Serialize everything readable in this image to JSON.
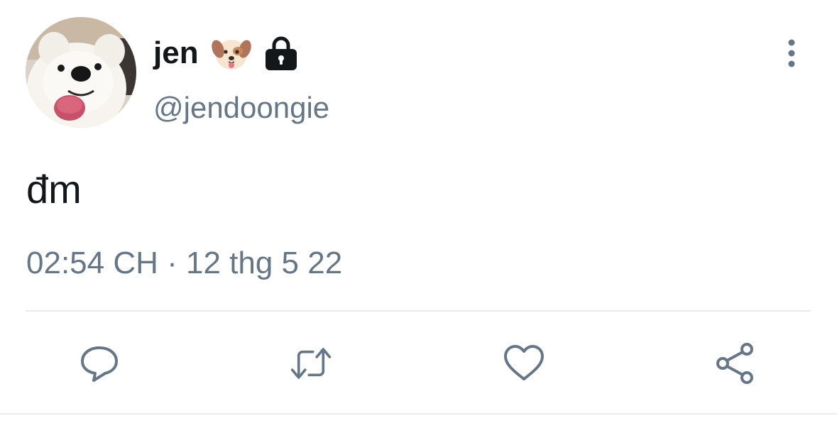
{
  "tweet": {
    "display_name": "jen",
    "handle": "@jendoongie",
    "text": "đm",
    "timestamp": "02:54 CH · 12 thg 5 22",
    "avatar": "samoyed-dog-photo",
    "badges": [
      "dog-face-emoji",
      "lock-icon"
    ]
  },
  "actions": {
    "reply": "reply-icon",
    "retweet": "retweet-icon",
    "like": "heart-icon",
    "share": "share-icon",
    "more": "more-vertical-icon"
  },
  "colors": {
    "primary_text": "#14171a",
    "secondary_text": "#657786",
    "divider": "#e6ecf0",
    "icon": "#657786"
  }
}
